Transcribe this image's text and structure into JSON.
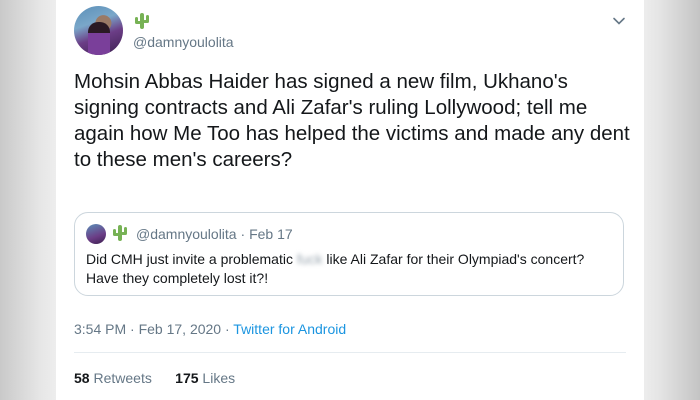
{
  "tweet": {
    "handle": "@damnyoulolita",
    "body_text": "Mohsin Abbas Haider has signed a new film, Ukhano's signing contracts and Ali Zafar's ruling Lollywood; tell me again how Me Too has helped the victims and made any dent to these men's careers?",
    "timestamp": "3:54 PM · Feb 17, 2020",
    "separator": " · ",
    "source": "Twitter for Android",
    "retweets_count": "58",
    "retweets_label": "Retweets",
    "likes_count": "175",
    "likes_label": "Likes",
    "icons": {
      "avatar": "profile-photo",
      "name_emoji": "cactus-icon",
      "menu": "chevron-down-icon"
    }
  },
  "quoted_tweet": {
    "handle": "@damnyoulolita",
    "date": "Feb 17",
    "date_separator": " · ",
    "text_before": "Did CMH just invite a problematic ",
    "text_blurred": "fuck",
    "text_after": " like Ali Zafar for their Olympiad's concert? Have they completely lost it?!"
  },
  "colors": {
    "link": "#1b95e0",
    "secondary_text": "#657786",
    "primary_text": "#14171a",
    "border": "#ccd6dd",
    "cactus": "#77b255"
  }
}
